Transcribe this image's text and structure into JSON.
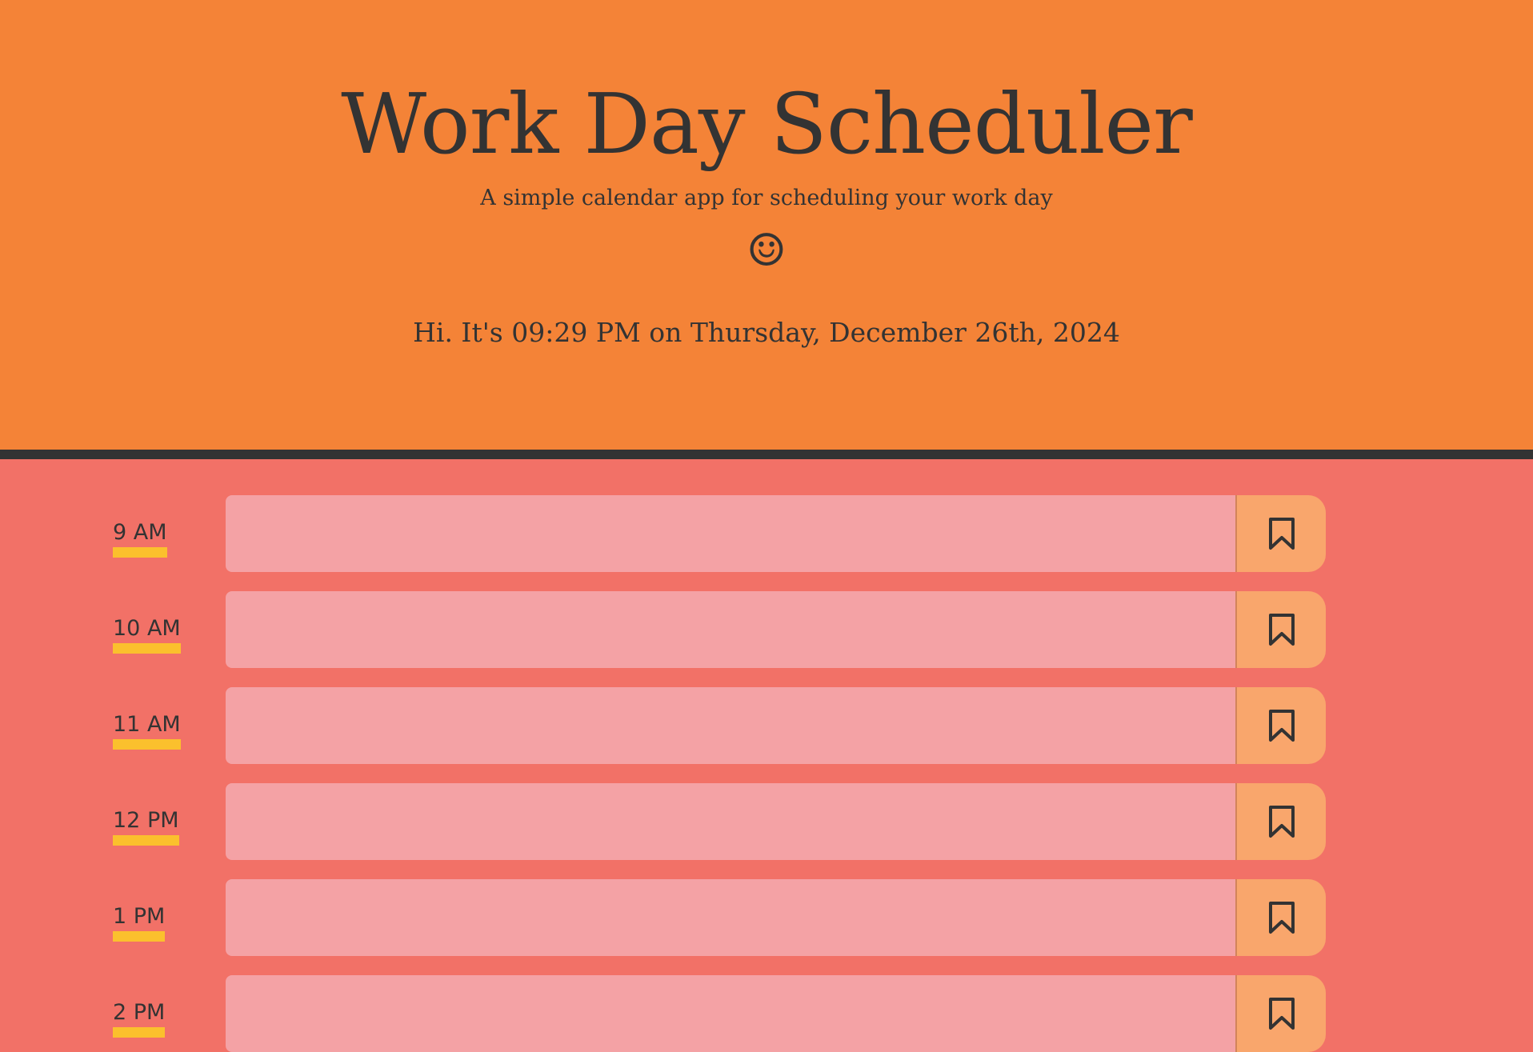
{
  "header": {
    "title": "Work Day Scheduler",
    "subtitle": "A simple calendar app for scheduling your work day",
    "emoji": "☺",
    "current_time": "Hi. It's 09:29 PM on Thursday, December 26th, 2024"
  },
  "schedule": {
    "rows": [
      {
        "hour": "9 AM",
        "text": "",
        "save_icon": "bookmark-icon"
      },
      {
        "hour": "10 AM",
        "text": "",
        "save_icon": "bookmark-icon"
      },
      {
        "hour": "11 AM",
        "text": "",
        "save_icon": "bookmark-icon"
      },
      {
        "hour": "12 PM",
        "text": "",
        "save_icon": "bookmark-icon"
      },
      {
        "hour": "1 PM",
        "text": "",
        "save_icon": "bookmark-icon"
      },
      {
        "hour": "2 PM",
        "text": "",
        "save_icon": "bookmark-icon"
      }
    ]
  },
  "colors": {
    "header_bg": "#F48337",
    "page_bg": "#F27167",
    "divider": "#333333",
    "textarea_past": "#F4A2A5",
    "save_button": "#F9A66C",
    "hour_underline": "#FBC02D",
    "text": "#333333"
  }
}
